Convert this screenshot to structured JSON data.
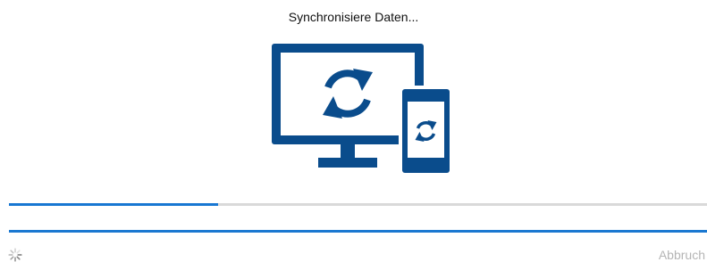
{
  "dialog": {
    "title": "Synchronisiere Daten...",
    "cancel_label": "Abbruch"
  },
  "progress": {
    "value": 0.3
  },
  "icons": {
    "illustration": "monitor-phone-sync-icon",
    "spinner": "loading-spinner-icon"
  },
  "colors": {
    "icon": "#0a4c8c",
    "accent": "#1877d2",
    "track": "#d9d9d9",
    "cancel_text": "#b5b5b5"
  }
}
